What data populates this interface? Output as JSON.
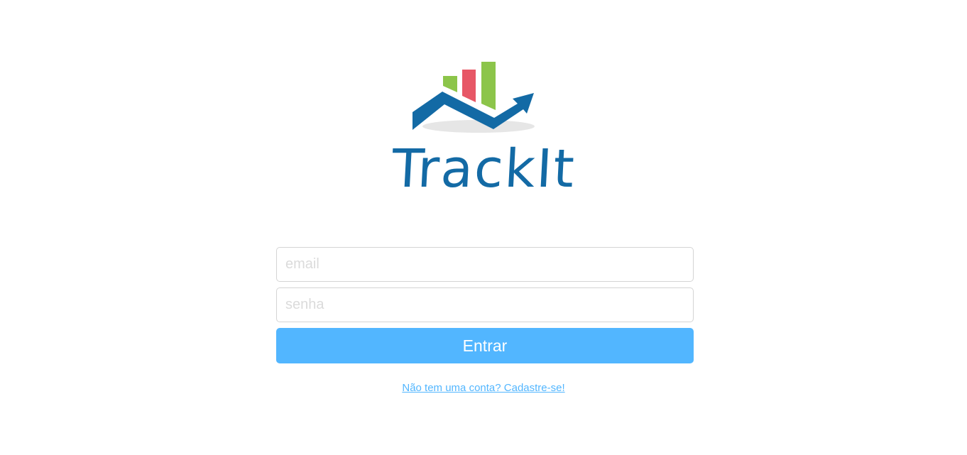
{
  "brand": {
    "name": "TrackIt",
    "colors": {
      "primary": "#136aa5",
      "bar_green": "#8cc54a",
      "bar_red": "#e75766",
      "shadow": "#e6e6e6"
    }
  },
  "login_form": {
    "email_placeholder": "email",
    "password_placeholder": "senha",
    "submit_label": "Entrar",
    "accent_color": "#52b6ff"
  },
  "signup_link": {
    "label": "Não tem uma conta? Cadastre-se!"
  }
}
